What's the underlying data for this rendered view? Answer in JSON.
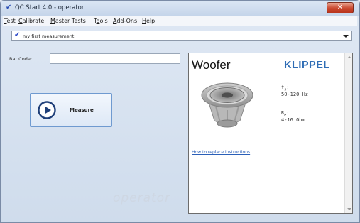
{
  "window": {
    "title": "QC Start 4.0 - operator",
    "close_label": "✕"
  },
  "menu": {
    "items": [
      {
        "label": "Test",
        "accel": "T",
        "rest": "est"
      },
      {
        "label": "Calibrate",
        "accel": "C",
        "rest": "alibrate"
      },
      {
        "label": "Master Tests",
        "accel": "M",
        "rest": "aster Tests"
      },
      {
        "label": "Tools",
        "pre": "T",
        "accel": "o",
        "rest": "ols"
      },
      {
        "label": "Add-Ons",
        "accel": "A",
        "rest": "dd-Ons"
      },
      {
        "label": "Help",
        "accel": "H",
        "rest": "elp"
      }
    ]
  },
  "test_select": {
    "value": "my first measurement"
  },
  "barcode": {
    "label": "Bar Code:",
    "value": ""
  },
  "measure": {
    "label": "Measure"
  },
  "watermark": "operator",
  "panel": {
    "title": "Woofer",
    "brand": "KLIPPEL",
    "fs_label": "f",
    "fs_sub": "s",
    "fs_value": "50-120 Hz",
    "re_label": "R",
    "re_sub": "e",
    "re_value": "4-16 Ohm",
    "link": "How to replace instructions"
  },
  "colors": {
    "accent": "#2f6db5",
    "close": "#c9472e",
    "link": "#2a5fb8"
  }
}
